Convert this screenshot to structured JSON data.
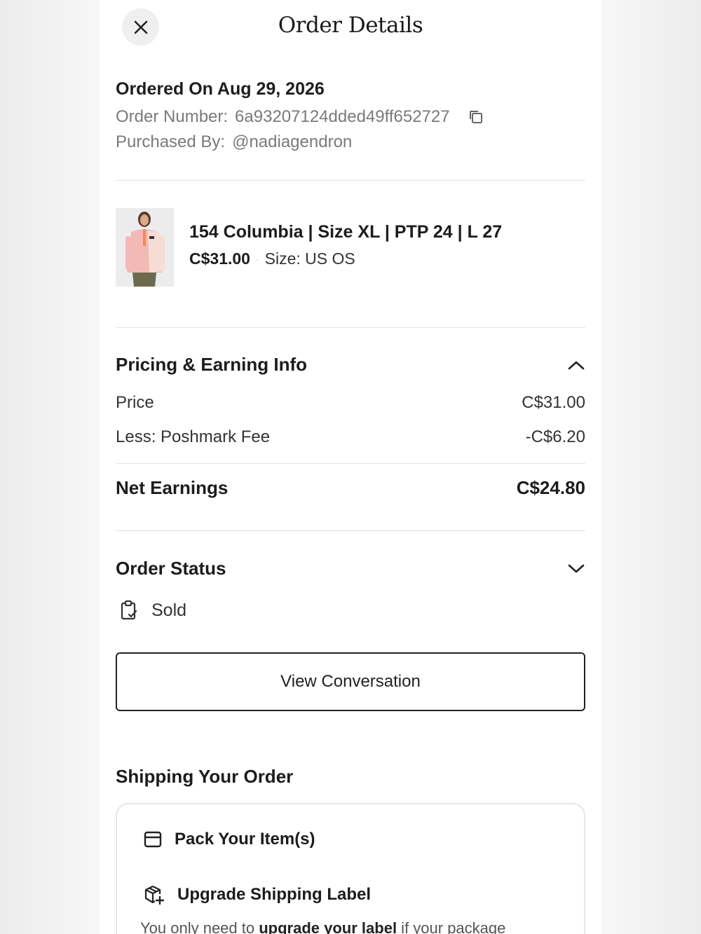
{
  "header": {
    "title": "Order Details",
    "close_icon": "close-icon"
  },
  "order": {
    "ordered_on": "Ordered On Aug 29, 2026",
    "order_number_label": "Order Number:",
    "order_number": "6a93207124dded49ff652727",
    "purchased_by_label": "Purchased By:",
    "purchased_by": "@nadiagendron"
  },
  "item": {
    "title": "154 Columbia | Size XL | PTP 24 | L 27",
    "price": "C$31.00",
    "separator": "·",
    "size": "Size: US OS"
  },
  "pricing": {
    "title": "Pricing & Earning Info",
    "rows": [
      {
        "label": "Price",
        "value": "C$31.00"
      },
      {
        "label": "Less: Poshmark Fee",
        "value": "-C$6.20"
      }
    ],
    "net_label": "Net Earnings",
    "net_value": "C$24.80"
  },
  "status": {
    "title": "Order Status",
    "current": "Sold"
  },
  "actions": {
    "view_conversation": "View Conversation"
  },
  "shipping": {
    "title": "Shipping Your Order",
    "steps": [
      {
        "label": "Pack Your Item(s)",
        "icon": "box-icon"
      },
      {
        "label": "Upgrade Shipping Label",
        "icon": "package-plus-icon"
      }
    ],
    "note_prefix": "You only need to ",
    "note_link": "upgrade your label",
    "note_suffix": " if your package"
  },
  "colors": {
    "text": "#1c1c1c",
    "muted": "#7a7a7a",
    "divider": "#e3e3e3",
    "button_border": "#222222"
  }
}
